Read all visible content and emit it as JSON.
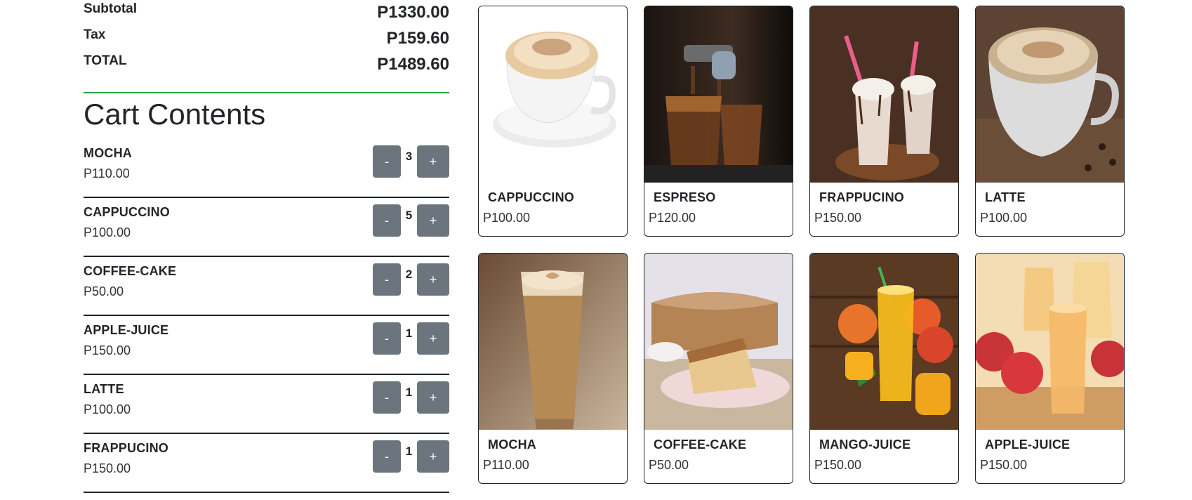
{
  "summary": {
    "subtotal_label": "Subtotal",
    "subtotal_value": "P1330.00",
    "tax_label": "Tax",
    "tax_value": "P159.60",
    "total_label": "TOTAL",
    "total_value": "P1489.60"
  },
  "cart": {
    "title": "Cart Contents",
    "minus_label": "-",
    "plus_label": "+",
    "items": [
      {
        "name": "MOCHA",
        "price": "P110.00",
        "qty": "3"
      },
      {
        "name": "CAPPUCCINO",
        "price": "P100.00",
        "qty": "5"
      },
      {
        "name": "COFFEE-CAKE",
        "price": "P50.00",
        "qty": "2"
      },
      {
        "name": "APPLE-JUICE",
        "price": "P150.00",
        "qty": "1"
      },
      {
        "name": "LATTE",
        "price": "P100.00",
        "qty": "1"
      },
      {
        "name": "FRAPPUCINO",
        "price": "P150.00",
        "qty": "1"
      }
    ]
  },
  "products": [
    {
      "name": "CAPPUCCINO",
      "price": "P100.00"
    },
    {
      "name": "ESPRESO",
      "price": "P120.00"
    },
    {
      "name": "FRAPPUCINO",
      "price": "P150.00"
    },
    {
      "name": "LATTE",
      "price": "P100.00"
    },
    {
      "name": "MOCHA",
      "price": "P110.00"
    },
    {
      "name": "COFFEE-CAKE",
      "price": "P50.00"
    },
    {
      "name": "MANGO-JUICE",
      "price": "P150.00"
    },
    {
      "name": "APPLE-JUICE",
      "price": "P150.00"
    }
  ],
  "colors": {
    "accent_line": "#28a745",
    "qty_button": "#6c757d"
  }
}
